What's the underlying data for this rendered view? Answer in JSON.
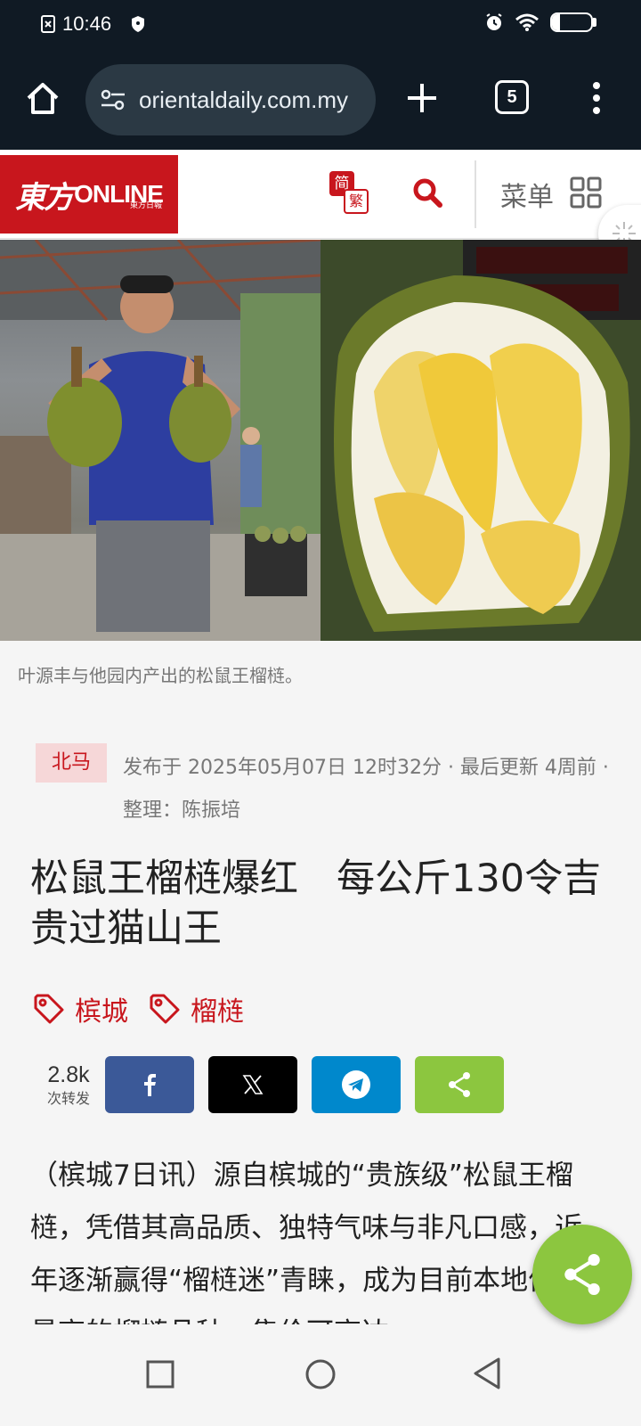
{
  "status_bar": {
    "time": "10:46",
    "battery": "21",
    "battery_level": 0.21
  },
  "browser": {
    "url": "orientaldaily.com.my",
    "tab_count": "5"
  },
  "site": {
    "logo_cn": "東方",
    "logo_online": "ONLINE",
    "logo_small": "東方日報",
    "lang_simplified": "简",
    "lang_traditional": "繁",
    "menu_label": "菜单"
  },
  "article": {
    "image_caption": "叶源丰与他园内产出的松鼠王榴梿。",
    "region": "北马",
    "meta": "发布于 2025年05月07日 12时32分 · 最后更新 4周前 · 整理：陈振培",
    "title": "松鼠王榴梿爆红　每公斤130令吉贵过猫山王",
    "tags": [
      "槟城",
      "榴梿"
    ],
    "share_count": "2.8k",
    "share_label": "次转发",
    "body": "（槟城7日讯）源自槟城的“贵族级”松鼠王榴梿，凭借其高品质、独特气味与非凡口感，近年逐渐赢得“榴梿迷”青睐，成为目前本地价格最高的榴梿品种，售价可高达"
  },
  "colors": {
    "brand_red": "#c8161d",
    "facebook": "#3b5998",
    "x": "#000000",
    "telegram": "#0088cc",
    "share": "#8cc63f",
    "browser_bar": "#101a24"
  }
}
